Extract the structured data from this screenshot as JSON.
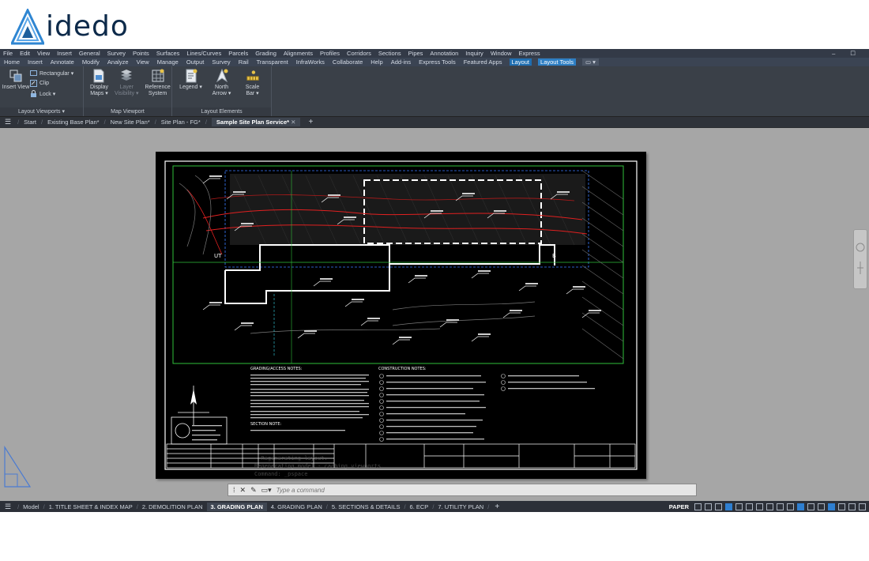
{
  "logo": {
    "text": "idedo"
  },
  "menubar": {
    "items": [
      "File",
      "Edit",
      "View",
      "Insert",
      "General",
      "Survey",
      "Points",
      "Surfaces",
      "Lines/Curves",
      "Parcels",
      "Grading",
      "Alignments",
      "Profiles",
      "Corridors",
      "Sections",
      "Pipes",
      "Annotation",
      "Inquiry",
      "Window",
      "Express"
    ],
    "controls": [
      "–",
      "☐"
    ]
  },
  "ribbon_tabs": {
    "items": [
      "Home",
      "Insert",
      "Annotate",
      "Modify",
      "Analyze",
      "View",
      "Manage",
      "Output",
      "Survey",
      "Rail",
      "Transparent",
      "InfraWorks",
      "Collaborate",
      "Help",
      "Add-ins",
      "Express Tools",
      "Featured Apps"
    ],
    "active": "Layout",
    "contextual": "Layout Tools",
    "mini": "▭ ▾"
  },
  "ribbon": {
    "layout_viewports": {
      "title": "Layout Viewports ▾",
      "insert_view": "Insert View",
      "rectangular": "Rectangular ▾",
      "clip": "Clip",
      "lock": "Lock ▾"
    },
    "map_viewport": {
      "title": "Map Viewport",
      "display_maps": [
        "Display",
        "Maps ▾"
      ],
      "layer_visibility": [
        "Layer",
        "Visibility ▾"
      ],
      "reference_system": [
        "Reference",
        "System"
      ]
    },
    "layout_elements": {
      "title": "Layout Elements",
      "legend": "Legend ▾",
      "north_arrow": [
        "North",
        "Arrow ▾"
      ],
      "scale_bar": [
        "Scale",
        "Bar ▾"
      ]
    }
  },
  "file_tabs": {
    "items": [
      "Start",
      "Existing Base Plan*",
      "New Site Plan*",
      "Site Plan - FG*"
    ],
    "active": "Sample Site Plan Service*"
  },
  "sheet": {
    "notes_left_title": "GRADING/ACCESS NOTES:",
    "notes_right_title": "CONSTRUCTION NOTES:",
    "section_title": "SECTION NOTE:",
    "callout_ut": "UT",
    "callout_b": "B"
  },
  "command": {
    "history": [
      "  Regenerating layout.",
      "Regenerating model - caching viewports.",
      "Command: _pspace"
    ],
    "placeholder": "Type a command"
  },
  "status": {
    "layout_tabs": [
      "Model",
      "1. TITLE SHEET & INDEX MAP",
      "2. DEMOLITION PLAN"
    ],
    "active_layout": "3. GRADING PLAN",
    "more_tabs": [
      "4. GRADING PLAN",
      "5. SECTIONS & DETAILS",
      "6. ECP",
      "7. UTILITY PLAN"
    ],
    "paper": "PAPER"
  },
  "colors": {
    "accent": "#1f6fb2",
    "canvas": "#a6a6a6",
    "sheet": "#000000",
    "logo": "#0d2a4a"
  }
}
